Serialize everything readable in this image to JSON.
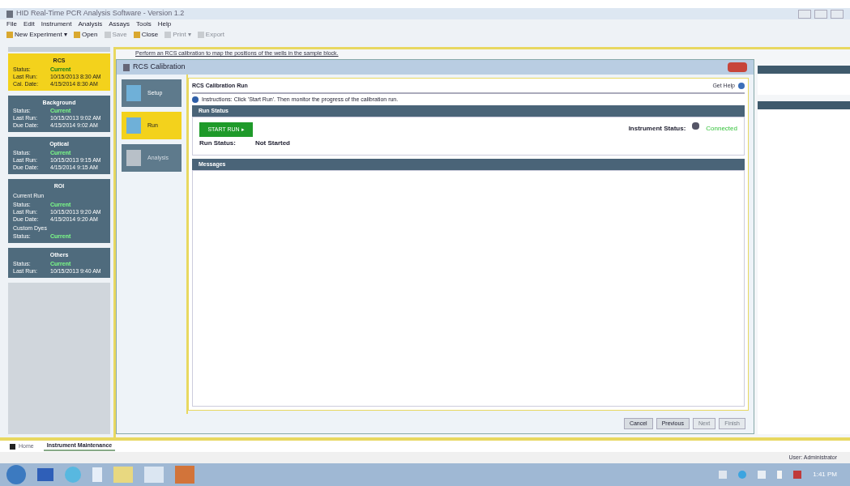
{
  "window": {
    "title": "HID Real-Time PCR Analysis Software - Version 1.2"
  },
  "menu": [
    "File",
    "Edit",
    "Instrument",
    "Analysis",
    "Assays",
    "Tools",
    "Help"
  ],
  "toolbar": [
    {
      "label": "New Experiment ▾",
      "disabled": false
    },
    {
      "label": "Open",
      "disabled": false
    },
    {
      "label": "Save",
      "disabled": true
    },
    {
      "label": "Close",
      "disabled": false
    },
    {
      "label": "Print ▾",
      "disabled": true
    },
    {
      "label": "Export",
      "disabled": true
    }
  ],
  "hint": "Perform an RCS calibration to map the positions of the wells in the sample block.",
  "status_cards": [
    {
      "title": "RCS",
      "selected": true,
      "sections": [
        {
          "rows": [
            {
              "label": "Status:",
              "value": "Current",
              "good": true
            },
            {
              "label": "Last Run:",
              "value": "10/15/2013 8:30 AM",
              "good": false
            },
            {
              "label": "Cal. Date:",
              "value": "4/15/2014 8:30 AM",
              "good": false
            }
          ]
        }
      ]
    },
    {
      "title": "Background",
      "selected": false,
      "sections": [
        {
          "rows": [
            {
              "label": "Status:",
              "value": "Current",
              "good": true
            },
            {
              "label": "Last Run:",
              "value": "10/15/2013 9:02 AM",
              "good": false
            },
            {
              "label": "Due Date:",
              "value": "4/15/2014 9:02 AM",
              "good": false
            }
          ]
        }
      ]
    },
    {
      "title": "Optical",
      "selected": false,
      "sections": [
        {
          "rows": [
            {
              "label": "Status:",
              "value": "Current",
              "good": true
            },
            {
              "label": "Last Run:",
              "value": "10/15/2013 9:15 AM",
              "good": false
            },
            {
              "label": "Due Date:",
              "value": "4/15/2014 9:15 AM",
              "good": false
            }
          ]
        }
      ]
    },
    {
      "title": "ROI",
      "selected": false,
      "sections": [
        {
          "heading": "Current Run",
          "rows": [
            {
              "label": "Status:",
              "value": "Current",
              "good": true
            },
            {
              "label": "Last Run:",
              "value": "10/15/2013 9:20 AM",
              "good": false
            },
            {
              "label": "Due Date:",
              "value": "4/15/2014 9:20 AM",
              "good": false
            }
          ]
        },
        {
          "heading": "Custom Dyes",
          "rows": [
            {
              "label": "Status:",
              "value": "Current",
              "good": true
            }
          ]
        }
      ]
    },
    {
      "title": "Others",
      "selected": false,
      "sections": [
        {
          "rows": [
            {
              "label": "Status:",
              "value": "Current",
              "good": true
            },
            {
              "label": "Last Run:",
              "value": "10/15/2013 9:40 AM",
              "good": false
            }
          ]
        }
      ]
    }
  ],
  "dialog": {
    "title": "RCS Calibration",
    "steps": [
      {
        "label": "Setup",
        "selected": false,
        "disabled": false
      },
      {
        "label": "Run",
        "selected": true,
        "disabled": false
      },
      {
        "label": "Analysis",
        "selected": false,
        "disabled": true
      }
    ],
    "heading": "RCS Calibration Run",
    "help": "Get Help",
    "instructions": "Instructions:   Click 'Start Run'. Then monitor the progress of the calibration run.",
    "run_status": {
      "header": "Run Status",
      "button": "START RUN ▸",
      "label": "Run Status:",
      "value": "Not Started",
      "instrument_label": "Instrument Status:",
      "instrument_value": "Connected"
    },
    "messages": {
      "header": "Messages"
    },
    "buttons": [
      {
        "label": "Cancel",
        "disabled": false
      },
      {
        "label": "Previous",
        "disabled": false
      },
      {
        "label": "Next",
        "disabled": true
      },
      {
        "label": "Finish",
        "disabled": true
      }
    ]
  },
  "tabs": [
    {
      "label": "Home",
      "selected": false
    },
    {
      "label": "Instrument Maintenance",
      "selected": true
    }
  ],
  "status_bar": {
    "user": "User: Administrator"
  },
  "taskbar": {
    "time": "1:41 PM"
  }
}
